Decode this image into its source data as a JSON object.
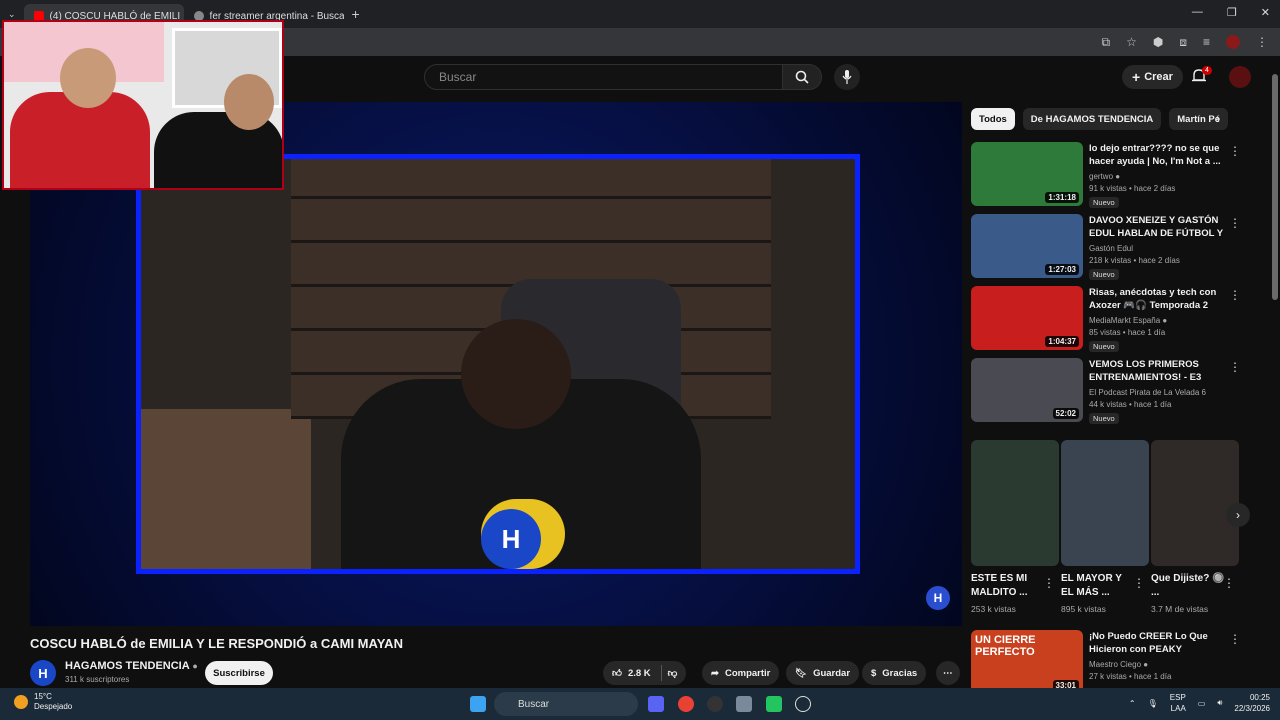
{
  "browser": {
    "tabs": [
      {
        "label": "(4) COSCU HABLÓ de EMILI",
        "active": true
      },
      {
        "label": "fer streamer argentina - Buscar",
        "active": false
      }
    ],
    "new_tab": "+",
    "win_min": "—",
    "win_max": "❐",
    "win_close": "✕"
  },
  "youtube": {
    "search_placeholder": "Buscar",
    "create_label": "Crear",
    "notification_count": "4"
  },
  "video": {
    "title": "COSCU HABLÓ de EMILIA Y LE RESPONDIÓ a CAMI MAYAN",
    "channel": "HAGAMOS TENDENCIA",
    "subscribers": "311 k suscriptores",
    "subscribe_label": "Suscribirse",
    "likes": "2.8 K",
    "share_label": "Compartir",
    "save_label": "Guardar",
    "thanks_label": "Gracias",
    "channel_logo": "H"
  },
  "chips": [
    "Todos",
    "De HAGAMOS TENDENCIA",
    "Martín Pé"
  ],
  "recommended": [
    {
      "title": "lo dejo entrar???? no se que hacer ayuda | No, I'm Not a ...",
      "channel": "gertwo",
      "meta": "91 k vistas • hace 2 días",
      "duration": "1:31:18",
      "badge": "Nuevo",
      "thumb_color": "#2d7a3a"
    },
    {
      "title": "DAVOO XENEIZE Y GASTÓN EDUL HABLAN DE FÚTBOL Y ...",
      "channel": "Gastón Edul",
      "meta": "218 k vistas • hace 2 días",
      "duration": "1:27:03",
      "badge": "Nuevo",
      "thumb_color": "#3a5a8a"
    },
    {
      "title": "Risas, anécdotas y tech con Axozer 🎮🎧 Temporada 2 Ep...",
      "channel": "MediaMarkt España",
      "meta": "85 vistas • hace 1 día",
      "duration": "1:04:37",
      "badge": "Nuevo",
      "thumb_color": "#c81e1e"
    },
    {
      "title": "VEMOS LOS PRIMEROS ENTRENAMIENTOS! - E3",
      "channel": "El Podcast Pirata de La Velada 6",
      "meta": "44 k vistas • hace 1 día",
      "duration": "52:02",
      "badge": "Nuevo",
      "thumb_color": "#4a4a52"
    }
  ],
  "shorts": [
    {
      "title": "ESTE ES MI MALDITO ...",
      "views": "253 k vistas",
      "color": "#2a3a30"
    },
    {
      "title": "EL MAYOR Y EL MÁS ...",
      "views": "895 k vistas",
      "color": "#3a4450"
    },
    {
      "title": "Que Dijiste? 🔘 ...",
      "views": "3.7 M de vistas",
      "color": "#2f2a28"
    }
  ],
  "last_video": {
    "title": "¡No Puedo CREER Lo Que Hicieron con PEAKY BLINDER...",
    "channel": "Maestro Ciego",
    "meta": "27 k vistas • hace 1 día",
    "duration": "33:01",
    "thumb_text": "UN CIERRE PERFECTO",
    "thumb_color": "#c8401e"
  },
  "taskbar": {
    "temp": "15°C",
    "weather": "Despejado",
    "search": "Buscar",
    "lang1": "ESP",
    "lang2": "LAA",
    "time": "00:25",
    "date": "22/3/2026"
  }
}
